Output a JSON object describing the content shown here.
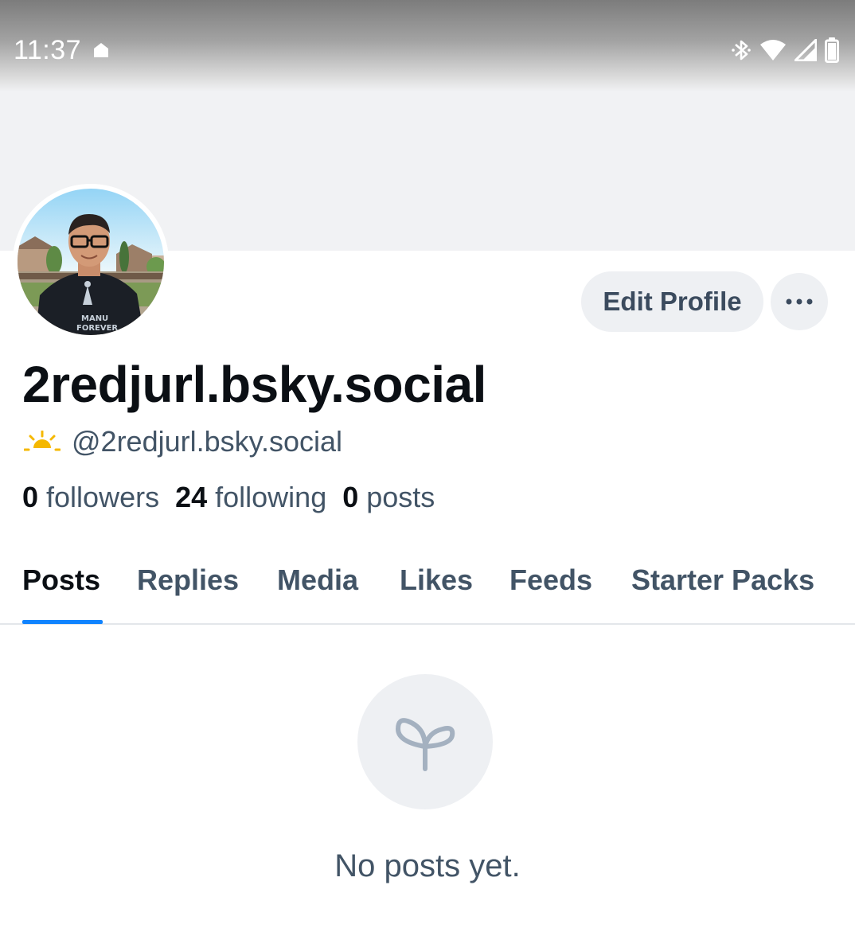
{
  "status_bar": {
    "time": "11:37",
    "icons": [
      "home-icon",
      "bluetooth-icon",
      "wifi-icon",
      "cell-signal-icon",
      "battery-icon"
    ]
  },
  "profile": {
    "display_name": "2redjurl.bsky.social",
    "handle": "@2redjurl.bsky.social",
    "handle_icon": "sunrise-icon",
    "avatar_shirt_text": "MANU FOREVER",
    "stats": {
      "followers_count": "0",
      "followers_label": "followers",
      "following_count": "24",
      "following_label": "following",
      "posts_count": "0",
      "posts_label": "posts"
    }
  },
  "actions": {
    "edit_profile_label": "Edit Profile",
    "more_icon": "ellipsis-icon"
  },
  "tabs": [
    {
      "label": "Posts",
      "active": true
    },
    {
      "label": "Replies",
      "active": false
    },
    {
      "label": "Media",
      "active": false
    },
    {
      "label": "Likes",
      "active": false
    },
    {
      "label": "Feeds",
      "active": false
    },
    {
      "label": "Starter Packs",
      "active": false
    }
  ],
  "empty_state": {
    "icon": "sprout-icon",
    "message": "No posts yet."
  },
  "colors": {
    "accent": "#1083fe",
    "text_primary": "#0b0f14",
    "text_secondary": "#425466",
    "surface_muted": "#eef0f3",
    "sunrise": "#f5b800"
  }
}
